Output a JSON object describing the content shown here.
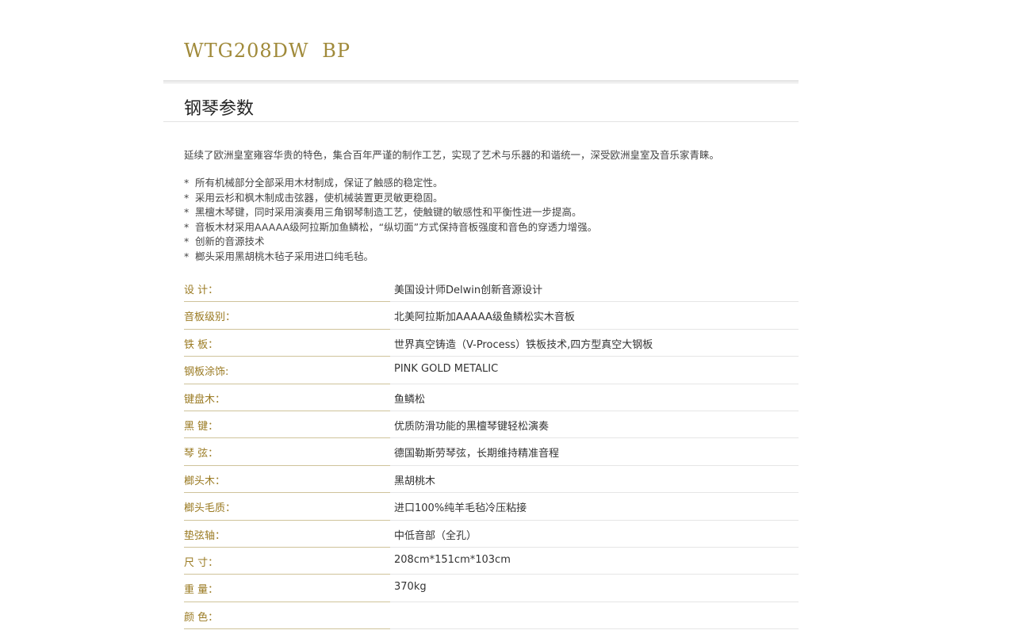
{
  "product": {
    "model": "WTG208DW BP",
    "section_title": "钢琴参数"
  },
  "intro": "延续了欧洲皇室雍容华贵的特色，集合百年严谨的制作工艺，实现了艺术与乐器的和谐统一，深受欧洲皇室及音乐家青睐。",
  "features": [
    "所有机械部分全部采用木材制成，保证了触感的稳定性。",
    "采用云杉和枫木制成击弦器，使机械装置更灵敏更稳固。",
    "黑檀木琴键，同时采用演奏用三角钢琴制造工艺，使触键的敏感性和平衡性进一步提高。",
    "音板木材采用AAAAA级阿拉斯加鱼鳞松，“纵切面”方式保持音板强度和音色的穿透力增强。",
    "创新的音源技术",
    "榔头采用黑胡桃木毡子采用进口纯毛毡。"
  ],
  "specs": [
    {
      "label": "设 计：",
      "value": "美国设计师Delwin创新音源设计"
    },
    {
      "label": "音板级别：",
      "value": "北美阿拉斯加AAAAA级鱼鳞松实木音板"
    },
    {
      "label": "铁 板：",
      "value": "世界真空铸造（V-Process）铁板技术,四方型真空大钢板"
    },
    {
      "label": "钢板涂饰:",
      "value": "PINK GOLD METALIC"
    },
    {
      "label": "键盘木：",
      "value": "鱼鳞松"
    },
    {
      "label": "黑 键：",
      "value": "优质防滑功能的黑檀琴键轻松演奏"
    },
    {
      "label": "琴 弦：",
      "value": "德国勒斯劳琴弦，长期维持精准音程"
    },
    {
      "label": "榔头木：",
      "value": "黑胡桃木"
    },
    {
      "label": "榔头毛质：",
      "value": "进口100%纯羊毛毡冷压粘接"
    },
    {
      "label": "垫弦轴：",
      "value": "中低音部（全孔）"
    },
    {
      "label": "尺 寸：",
      "value": "208cm*151cm*103cm"
    },
    {
      "label": "重 量：",
      "value": "370kg"
    },
    {
      "label": "颜 色：",
      "value": ""
    }
  ]
}
